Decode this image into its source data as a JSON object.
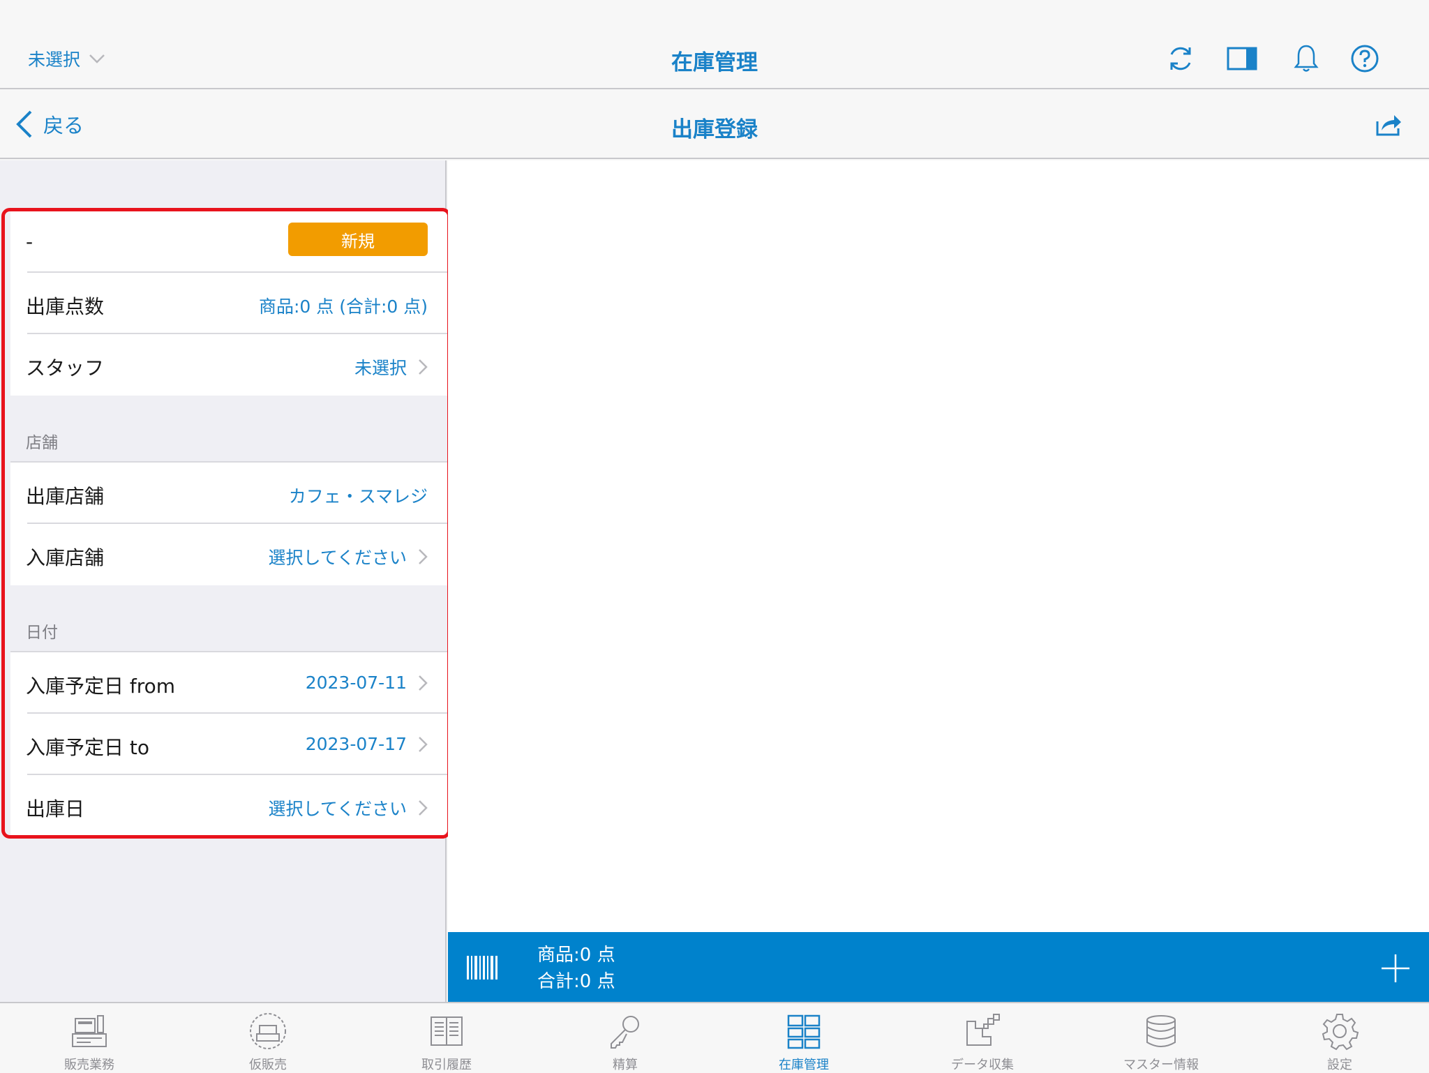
{
  "topbar": {
    "store_selector": "未選択",
    "title": "在庫管理",
    "icons": [
      "refresh-icon",
      "split-view-icon",
      "bell-icon",
      "help-icon"
    ]
  },
  "subbar": {
    "back_label": "戻る",
    "title": "出庫登録",
    "share_icon": "share-icon"
  },
  "form": {
    "status": {
      "label": "-",
      "badge": "新規"
    },
    "count": {
      "label": "出庫点数",
      "value": "商品:0 点 (合計:0 点)"
    },
    "staff": {
      "label": "スタッフ",
      "value": "未選択"
    },
    "store_section": "店舗",
    "from_store": {
      "label": "出庫店舗",
      "value": "カフェ・スマレジ"
    },
    "to_store": {
      "label": "入庫店舗",
      "value": "選択してください"
    },
    "date_section": "日付",
    "date_from": {
      "label": "入庫予定日 from",
      "value": "2023-07-11"
    },
    "date_to": {
      "label": "入庫予定日 to",
      "value": "2023-07-17"
    },
    "ship_date": {
      "label": "出庫日",
      "value": "選択してください"
    }
  },
  "bottom_bar": {
    "items": "商品:0 点",
    "total": "合計:0 点"
  },
  "tabs": [
    {
      "label": "販売業務",
      "icon": "register-icon"
    },
    {
      "label": "仮販売",
      "icon": "temp-sale-icon"
    },
    {
      "label": "取引履歴",
      "icon": "history-icon"
    },
    {
      "label": "精算",
      "icon": "key-icon"
    },
    {
      "label": "在庫管理",
      "icon": "inventory-icon",
      "active": true
    },
    {
      "label": "データ収集",
      "icon": "data-collect-icon"
    },
    {
      "label": "マスター情報",
      "icon": "database-icon"
    },
    {
      "label": "設定",
      "icon": "gear-icon"
    }
  ],
  "colors": {
    "accent": "#1a82c8",
    "badge": "#f29c00",
    "highlight_border": "#e8131c",
    "bottom_bar": "#0082cc"
  }
}
